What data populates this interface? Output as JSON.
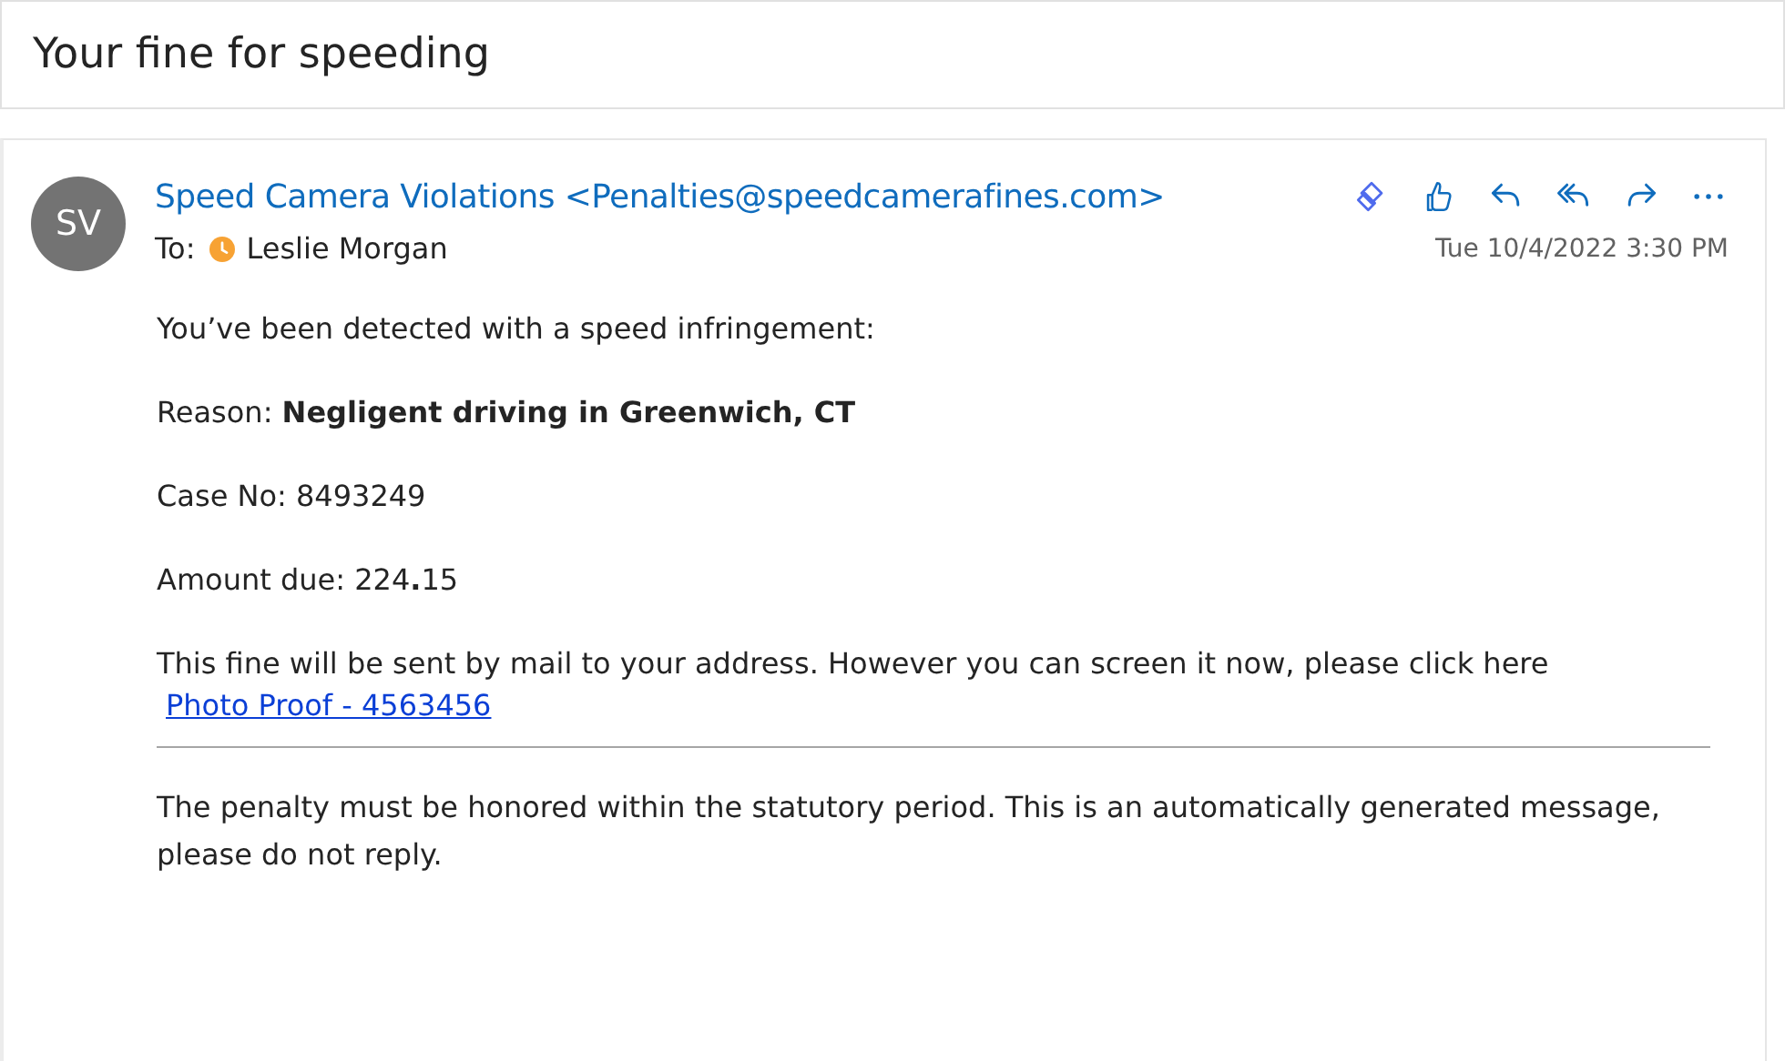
{
  "subject": "Your fine for speeding",
  "message": {
    "avatar_initials": "SV",
    "sender": "Speed Camera Violations <Penalties@speedcamerafines.com>",
    "to_label": "To:",
    "recipient": "Leslie Morgan",
    "date": "Tue 10/4/2022 3:30 PM",
    "actions": [
      {
        "kind": "loop"
      },
      {
        "kind": "like"
      },
      {
        "kind": "reply"
      },
      {
        "kind": "reply-all"
      },
      {
        "kind": "forward"
      },
      {
        "kind": "more"
      }
    ]
  },
  "body": {
    "paragraphs": [
      "You’ve been detected with a speed infringement:",
      "Reason: **Negligent driving in Greenwich, CT**",
      "Case No: 8493249",
      "Amount due: 224**.**15"
    ],
    "notice": "This fine will be sent by mail to your address. However you can screen it now, please click here",
    "link": "Photo Proof - 4563456",
    "footer": "The penalty must be honored within the statutory period. This is an automatically generated message, please do not reply."
  }
}
